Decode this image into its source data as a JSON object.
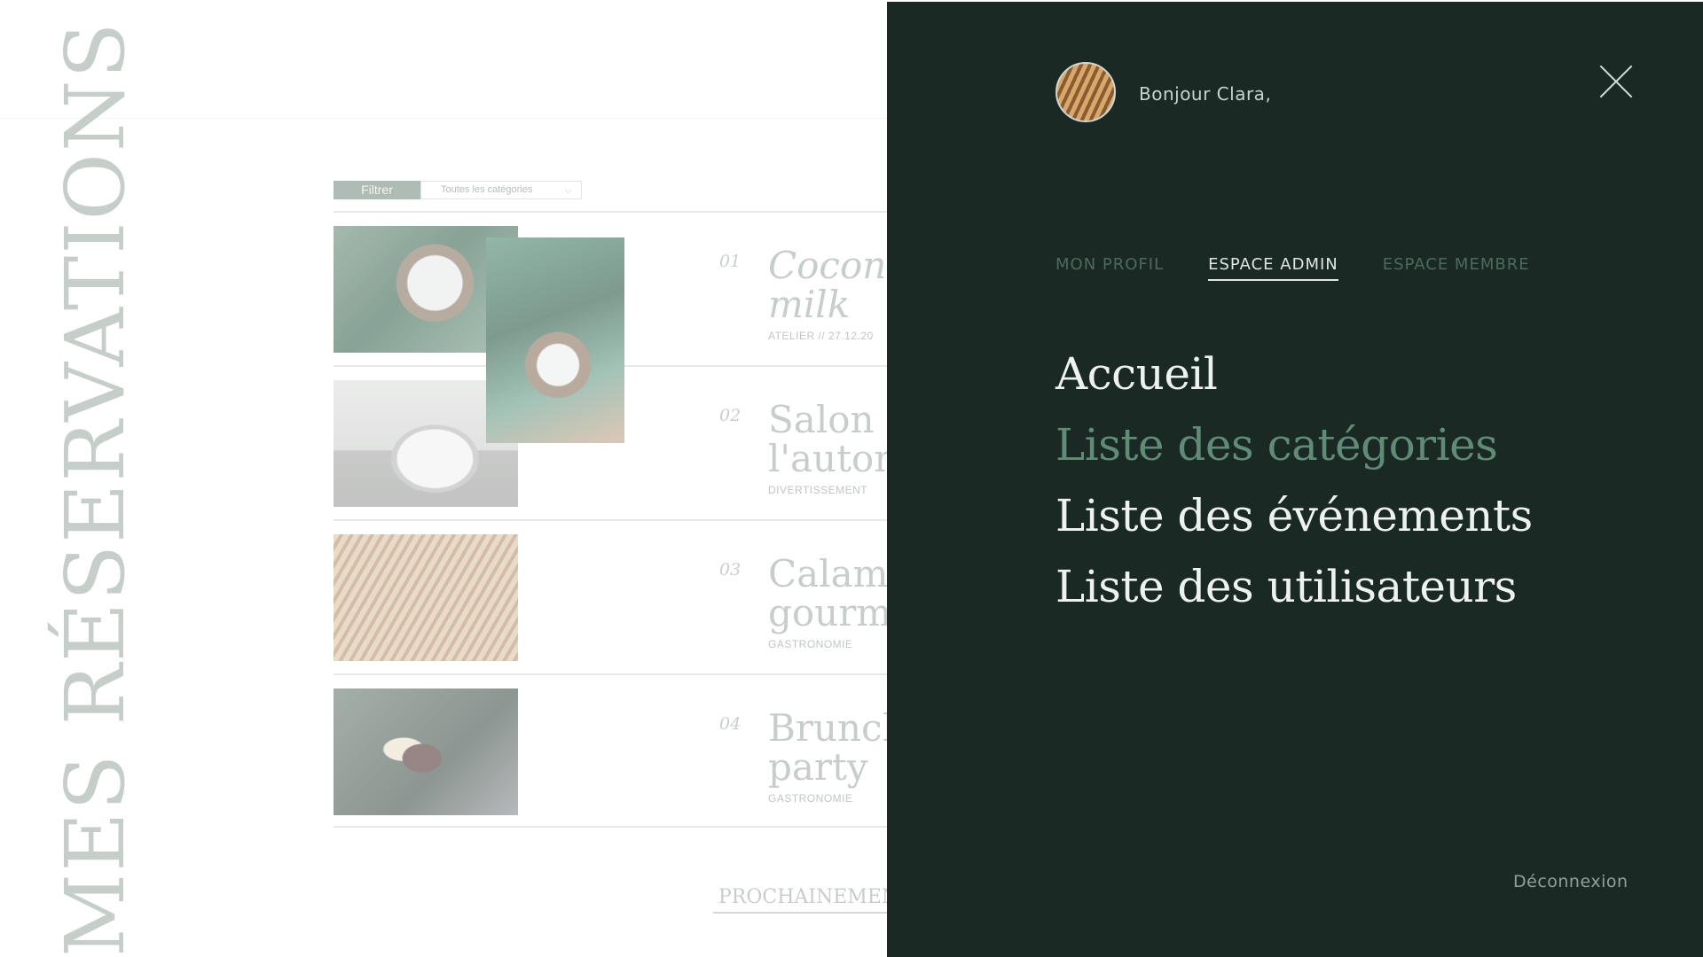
{
  "page": {
    "vertical_title": "MES RÉSERVATIONS",
    "filter": {
      "button_label": "Filtrer",
      "select_value": "Toutes les catégories"
    },
    "events": [
      {
        "number": "01",
        "title": "Coconut\nmilk",
        "meta": "ATELIER   //   27.12.20",
        "image": "coconut-image"
      },
      {
        "number": "02",
        "title": "Salon de\nl'automobile",
        "meta": "DIVERTISSEMENT",
        "image": "car-image"
      },
      {
        "number": "03",
        "title": "Calamars\ngourmets",
        "meta": "GASTRONOMIE",
        "image": "skewers-image"
      },
      {
        "number": "04",
        "title": "Brunch\nparty",
        "meta": "GASTRONOMIE",
        "image": "wine-image"
      }
    ],
    "next_link": "PROCHAINEMENT"
  },
  "menu": {
    "greeting": "Bonjour Clara,",
    "tabs": [
      {
        "label": "MON PROFIL",
        "active": false
      },
      {
        "label": "ESPACE ADMIN",
        "active": true
      },
      {
        "label": "ESPACE MEMBRE",
        "active": false
      }
    ],
    "nav": [
      {
        "label": "Accueil"
      },
      {
        "label": "Liste des  catégories",
        "current": true
      },
      {
        "label": "Liste des événements"
      },
      {
        "label": "Liste des utilisateurs"
      }
    ],
    "logout": "Déconnexion"
  },
  "colors": {
    "panel_bg": "#1a2924",
    "accent_green": "#5f8c77",
    "tab_inactive": "#4d6a5d",
    "text_light": "#eef2ef"
  },
  "icons": {
    "close": "close-icon",
    "dropdown": "chevron-down-icon",
    "avatar": "avatar-image"
  }
}
